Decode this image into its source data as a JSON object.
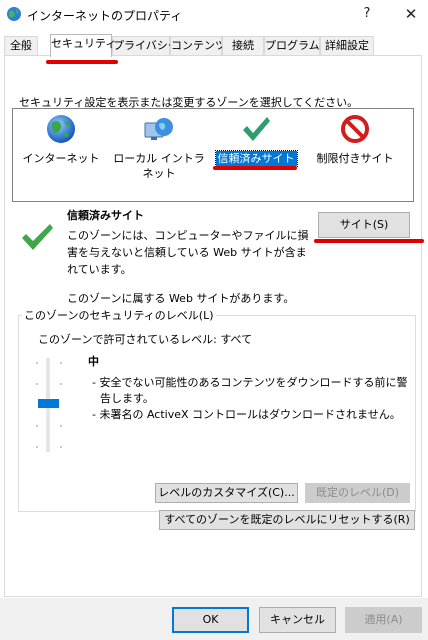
{
  "window": {
    "title": "インターネットのプロパティ",
    "help_glyph": "?",
    "close_glyph": "✕"
  },
  "tabs": [
    {
      "label": "全般"
    },
    {
      "label": "セキュリティ"
    },
    {
      "label": "プライバシー"
    },
    {
      "label": "コンテンツ"
    },
    {
      "label": "接続"
    },
    {
      "label": "プログラム"
    },
    {
      "label": "詳細設定"
    }
  ],
  "active_tab": "セキュリティ",
  "zones": {
    "instruction": "セキュリティ設定を表示または変更するゾーンを選択してください。",
    "items": [
      {
        "label": "インターネット",
        "icon": "globe-icon"
      },
      {
        "label": "ローカル イントラネット",
        "icon": "intranet-globe-icon"
      },
      {
        "label": "信頼済みサイト",
        "icon": "checkmark-icon",
        "selected": true
      },
      {
        "label": "制限付きサイト",
        "icon": "restricted-icon"
      }
    ]
  },
  "zone_info": {
    "title": "信頼済みサイト",
    "description": "このゾーンには、コンピューターやファイルに損害を与えないと信頼している Web サイトが含まれています。",
    "sites_button": "サイト(S)",
    "sites_note": "このゾーンに属する Web サイトがあります。"
  },
  "security_level": {
    "group_title": "このゾーンのセキュリティのレベル(L)",
    "allowed": "このゾーンで許可されているレベル: すべて",
    "level_name": "中",
    "bullets": [
      "- 安全でない可能性のあるコンテンツをダウンロードする前に警告します。",
      "- 未署名の ActiveX コントロールはダウンロードされません。"
    ],
    "custom_button": "レベルのカスタマイズ(C)...",
    "default_button": "既定のレベル(D)",
    "reset_all_button": "すべてのゾーンを既定のレベルにリセットする(R)"
  },
  "dialog_buttons": {
    "ok": "OK",
    "cancel": "キャンセル",
    "apply": "適用(A)"
  },
  "colors": {
    "annotation_red": "#e00000",
    "selection_blue": "#0078d7",
    "check_green": "#2f9e6f"
  }
}
